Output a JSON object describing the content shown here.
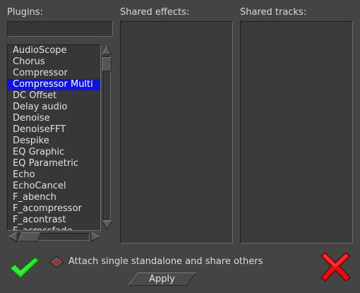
{
  "plugins": {
    "label": "Plugins:",
    "search_value": "",
    "items": [
      "AudioScope",
      "Chorus",
      "Compressor",
      "Compressor Multi",
      "DC Offset",
      "Delay audio",
      "Denoise",
      "DenoiseFFT",
      "Despike",
      "EQ Graphic",
      "EQ Parametric",
      "Echo",
      "EchoCancel",
      "F_abench",
      "F_acompressor",
      "F_acontrast",
      "F_acrossfade"
    ],
    "selected_index": 3
  },
  "shared_effects": {
    "label": "Shared effects:"
  },
  "shared_tracks": {
    "label": "Shared tracks:"
  },
  "attach_option": {
    "label": "Attach single standalone and share others",
    "checked": true
  },
  "apply_button": {
    "label": "Apply"
  },
  "colors": {
    "background": "#444444",
    "selection": "#0f14d8",
    "ok_green": "#1fd41f",
    "cancel_red": "#e01010"
  },
  "icons": {
    "ok": "checkmark-icon",
    "cancel": "cross-icon",
    "checkbox": "checkbox-checked-icon"
  }
}
